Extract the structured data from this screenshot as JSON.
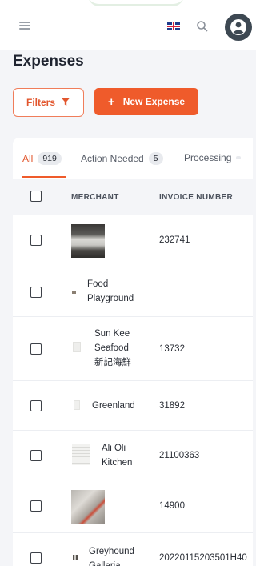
{
  "header": {
    "menu_icon": "hamburger-icon",
    "flag_icon": "uk-flag-icon",
    "search_icon": "search-icon",
    "avatar_icon": "user-avatar-icon"
  },
  "page": {
    "title": "Expenses"
  },
  "toolbar": {
    "filters_label": "Filters",
    "new_expense_label": "New Expense",
    "accent_color": "#ef5b2b"
  },
  "tabs": [
    {
      "label": "All",
      "count": "919",
      "active": true
    },
    {
      "label": "Action Needed",
      "count": "5",
      "active": false
    },
    {
      "label": "Processing",
      "count": "",
      "active": false
    }
  ],
  "table": {
    "headers": {
      "merchant": "MERCHANT",
      "invoice": "INVOICE NUMBER"
    },
    "rows": [
      {
        "merchant": "",
        "invoice": "232741",
        "thumb": "receipt-photo-dark"
      },
      {
        "merchant_lines": [
          "Food",
          "Playground"
        ],
        "invoice": "",
        "thumb": "tiny-logo"
      },
      {
        "merchant_lines": [
          "Sun Kee",
          "Seafood",
          "新記海鮮"
        ],
        "invoice": "13732",
        "thumb": "faint-receipt"
      },
      {
        "merchant_lines": [
          "Greenland"
        ],
        "invoice": "31892",
        "thumb": "faint-receipt"
      },
      {
        "merchant_lines": [
          "Ali Oli",
          "Kitchen"
        ],
        "invoice": "21100363",
        "thumb": "faint-receipt"
      },
      {
        "merchant": "",
        "invoice": "14900",
        "thumb": "receipt-photo-light"
      },
      {
        "merchant_lines": [
          "Greyhound",
          "Galleria"
        ],
        "invoice": "20220115203501H40",
        "thumb": "tiny-logo"
      }
    ]
  }
}
